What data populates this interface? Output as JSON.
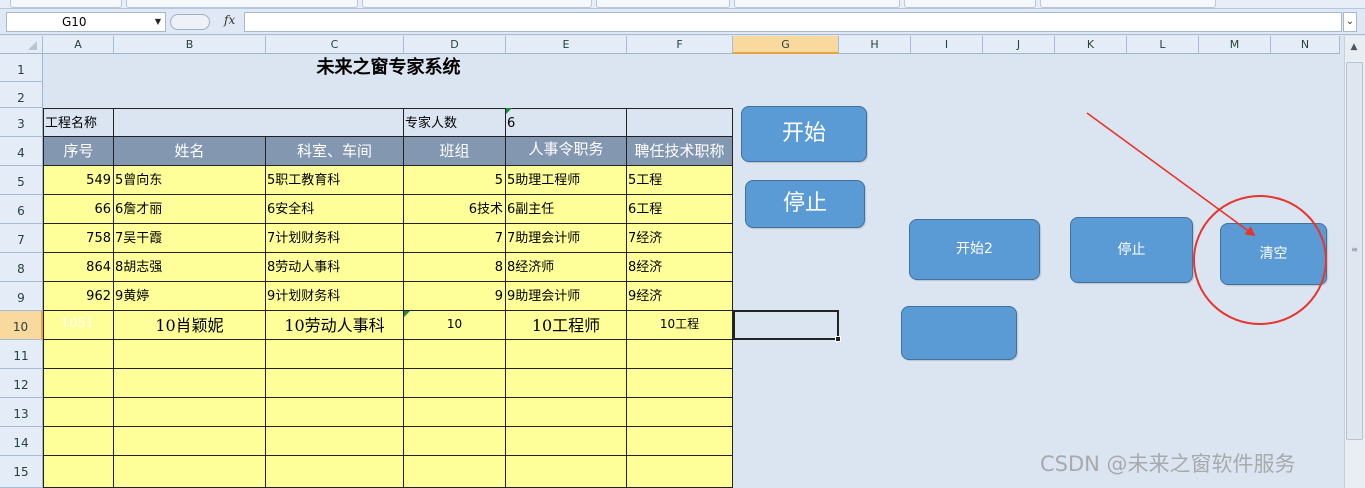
{
  "formula_bar": {
    "name_box": "G10",
    "fx_label": "fx",
    "formula": ""
  },
  "columns": [
    "A",
    "B",
    "C",
    "D",
    "E",
    "F",
    "G",
    "H",
    "I",
    "J",
    "K",
    "L",
    "M",
    "N"
  ],
  "rows": [
    "1",
    "2",
    "3",
    "4",
    "5",
    "6",
    "7",
    "8",
    "9",
    "10",
    "11",
    "12",
    "13",
    "14",
    "15"
  ],
  "sheet": {
    "title": "未来之窗专家系统",
    "project_label": "工程名称",
    "project_value": "",
    "experts_count_label": "专家人数",
    "experts_count_value": "6",
    "headers": [
      "序号",
      "姓名",
      "科室、车间",
      "班组",
      "人事令职务",
      "聘任技术职称"
    ],
    "rows": [
      {
        "no": "549",
        "name": "5曾向东",
        "dept": "5职工教育科",
        "group": "5",
        "position": "5助理工程师",
        "title": "5工程"
      },
      {
        "no": "66",
        "name": "6詹才丽",
        "dept": "6安全科",
        "group": "6技术",
        "position": "6副主任",
        "title": "6工程"
      },
      {
        "no": "758",
        "name": "7吴干霞",
        "dept": "7计划财务科",
        "group": "7",
        "position": "7助理会计师",
        "title": "7经济"
      },
      {
        "no": "864",
        "name": "8胡志强",
        "dept": "8劳动人事科",
        "group": "8",
        "position": "8经济师",
        "title": "8经济"
      },
      {
        "no": "962",
        "name": "9黄婷",
        "dept": "9计划财务科",
        "group": "9",
        "position": "9助理会计师",
        "title": "9经济"
      },
      {
        "no": "1051",
        "name": "10肖颖妮",
        "dept": "10劳动人事科",
        "group": "10",
        "position": "10工程师",
        "title": "10工程"
      }
    ]
  },
  "buttons": {
    "start": "开始",
    "stop": "停止",
    "start2": "开始2",
    "stop2": "停止",
    "clear": "清空",
    "blank": ""
  },
  "annotation": {
    "arrow_color": "#e8342c",
    "circle_color": "#e8342c"
  },
  "watermark": "CSDN @未来之窗软件服务",
  "colors": {
    "header_fill": "#8497b0",
    "data_fill": "#ffff99",
    "button_fill": "#5b9bd5",
    "grid_bg": "#dbe5f1"
  }
}
